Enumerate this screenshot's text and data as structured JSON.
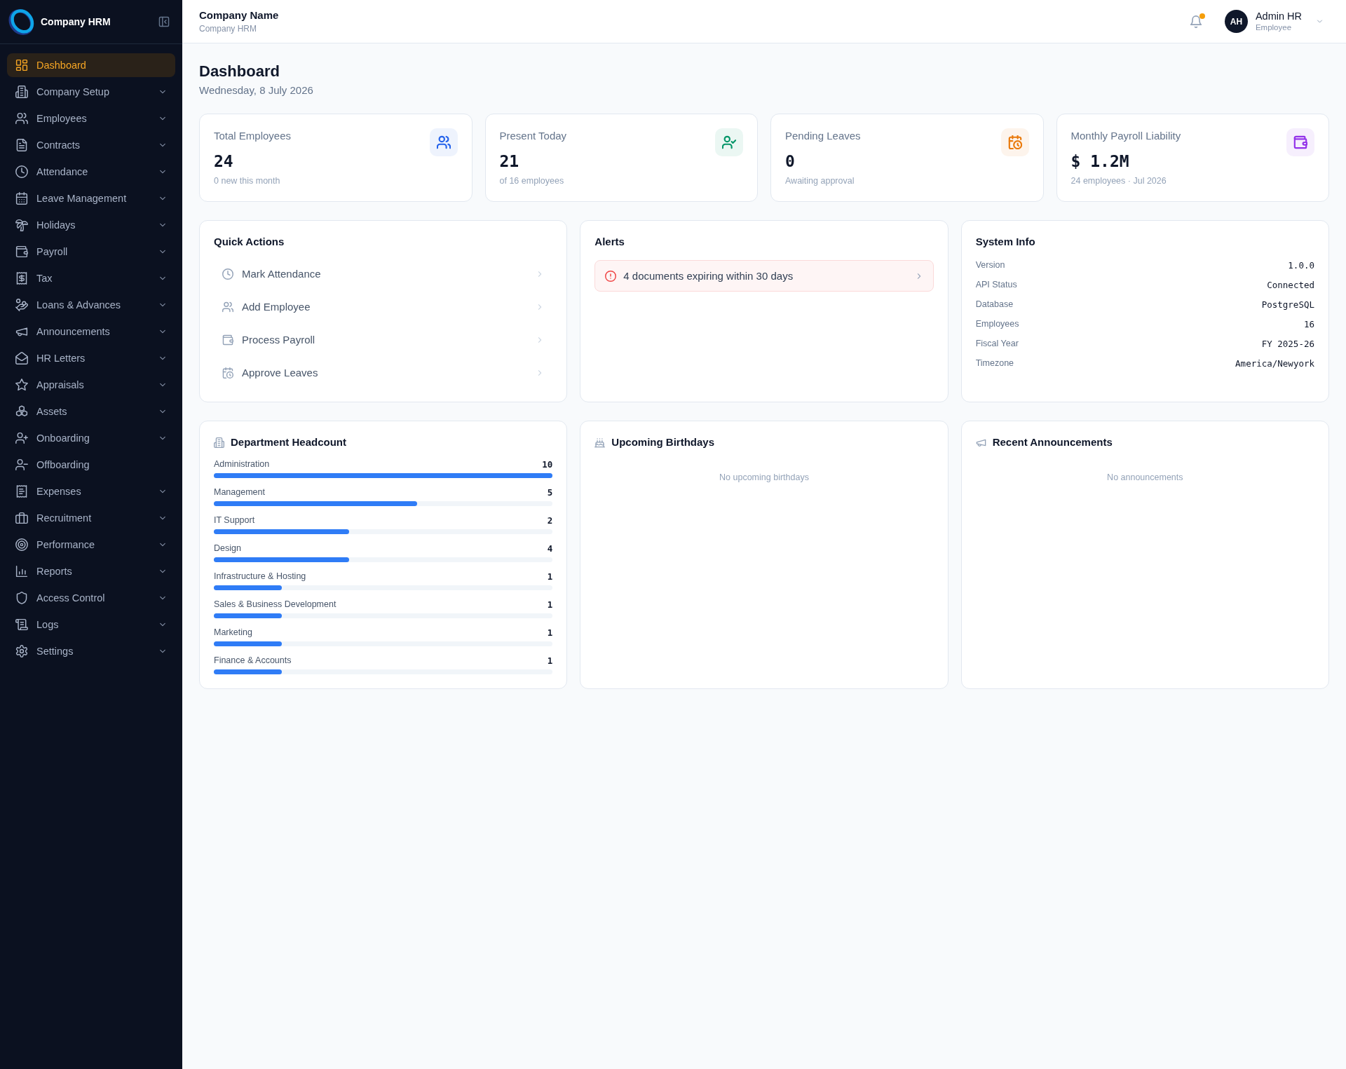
{
  "sidebar": {
    "brand": "Company HRM",
    "items": [
      {
        "label": "Dashboard",
        "selected": true,
        "has_submenu": false
      },
      {
        "label": "Company Setup",
        "selected": false,
        "has_submenu": true
      },
      {
        "label": "Employees",
        "selected": false,
        "has_submenu": true
      },
      {
        "label": "Contracts",
        "selected": false,
        "has_submenu": true
      },
      {
        "label": "Attendance",
        "selected": false,
        "has_submenu": true
      },
      {
        "label": "Leave Management",
        "selected": false,
        "has_submenu": true
      },
      {
        "label": "Holidays",
        "selected": false,
        "has_submenu": true
      },
      {
        "label": "Payroll",
        "selected": false,
        "has_submenu": true
      },
      {
        "label": "Tax",
        "selected": false,
        "has_submenu": true
      },
      {
        "label": "Loans & Advances",
        "selected": false,
        "has_submenu": true
      },
      {
        "label": "Announcements",
        "selected": false,
        "has_submenu": true
      },
      {
        "label": "HR Letters",
        "selected": false,
        "has_submenu": true
      },
      {
        "label": "Appraisals",
        "selected": false,
        "has_submenu": true
      },
      {
        "label": "Assets",
        "selected": false,
        "has_submenu": true
      },
      {
        "label": "Onboarding",
        "selected": false,
        "has_submenu": true
      },
      {
        "label": "Offboarding",
        "selected": false,
        "has_submenu": false
      },
      {
        "label": "Expenses",
        "selected": false,
        "has_submenu": true
      },
      {
        "label": "Recruitment",
        "selected": false,
        "has_submenu": true
      },
      {
        "label": "Performance",
        "selected": false,
        "has_submenu": true
      },
      {
        "label": "Reports",
        "selected": false,
        "has_submenu": true
      },
      {
        "label": "Access Control",
        "selected": false,
        "has_submenu": true
      },
      {
        "label": "Logs",
        "selected": false,
        "has_submenu": true
      },
      {
        "label": "Settings",
        "selected": false,
        "has_submenu": true
      }
    ]
  },
  "header": {
    "company": "Company Name",
    "subtitle": "Company HRM",
    "notifications": {
      "unread": true
    },
    "user": {
      "initials": "AH",
      "name": "Admin HR",
      "role": "Employee"
    }
  },
  "page": {
    "title": "Dashboard",
    "date": "Wednesday, 8 July 2026"
  },
  "stats": [
    {
      "label": "Total Employees",
      "value": "24",
      "note": "0 new this month",
      "color": "#2563eb"
    },
    {
      "label": "Present Today",
      "value": "21",
      "note": "of 16 employees",
      "color": "#059669"
    },
    {
      "label": "Pending Leaves",
      "value": "0",
      "note": "Awaiting approval",
      "color": "#ea7a0c"
    },
    {
      "label": "Monthly Payroll Liability",
      "value": "$ 1.2M",
      "note": "24 employees · Jul 2026",
      "color": "#9333ea"
    }
  ],
  "quick_actions": {
    "title": "Quick Actions",
    "items": [
      "Mark Attendance",
      "Add Employee",
      "Process Payroll",
      "Approve Leaves"
    ]
  },
  "alerts": {
    "title": "Alerts",
    "items": [
      {
        "text": "4 documents expiring within 30 days"
      }
    ]
  },
  "system_info": {
    "title": "System Info",
    "rows": [
      {
        "label": "Version",
        "value": "1.0.0"
      },
      {
        "label": "API Status",
        "value": "Connected"
      },
      {
        "label": "Database",
        "value": "PostgreSQL"
      },
      {
        "label": "Employees",
        "value": "16"
      },
      {
        "label": "Fiscal Year",
        "value": "FY 2025-26"
      },
      {
        "label": "Timezone",
        "value": "America/Newyork"
      }
    ]
  },
  "department_headcount": {
    "title": "Department Headcount",
    "rows": [
      {
        "name": "Administration",
        "count": "10",
        "level": 1.0
      },
      {
        "name": "Management",
        "count": "5",
        "level": 0.6
      },
      {
        "name": "IT Support",
        "count": "2",
        "level": 0.4
      },
      {
        "name": "Design",
        "count": "4",
        "level": 0.4
      },
      {
        "name": "Infrastructure & Hosting",
        "count": "1",
        "level": 0.2
      },
      {
        "name": "Sales & Business Development",
        "count": "1",
        "level": 0.2
      },
      {
        "name": "Marketing",
        "count": "1",
        "level": 0.2
      },
      {
        "name": "Finance & Accounts",
        "count": "1",
        "level": 0.2
      }
    ]
  },
  "upcoming_birthdays": {
    "title": "Upcoming Birthdays",
    "empty_text": "No upcoming birthdays"
  },
  "recent_announcements": {
    "title": "Recent Announcements",
    "empty_text": "No announcements"
  }
}
